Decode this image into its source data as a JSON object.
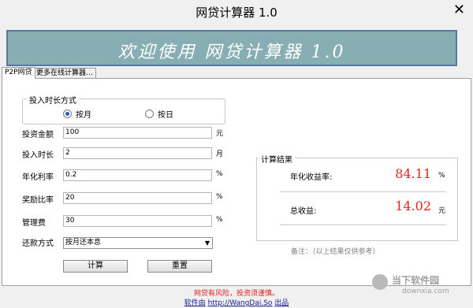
{
  "window": {
    "title": "网贷计算器 1.0",
    "close_glyph": "✕"
  },
  "banner": {
    "text": "欢迎使用  网贷计算器  1.0"
  },
  "tabs": [
    {
      "label": "P2P网贷"
    },
    {
      "label": "更多在线计算器…"
    }
  ],
  "investment_period_mode": {
    "legend": "投入时长方式",
    "options": [
      {
        "label": "按月",
        "checked": true
      },
      {
        "label": "按日",
        "checked": false
      }
    ]
  },
  "fields": {
    "amount": {
      "label": "投资金额",
      "value": "100",
      "unit": "元"
    },
    "duration": {
      "label": "投入时长",
      "value": "2",
      "unit": "月"
    },
    "annual_rate": {
      "label": "年化利率",
      "value": "0.2",
      "unit": "%"
    },
    "reward_rate": {
      "label": "奖励比率",
      "value": "20",
      "unit": "%"
    },
    "management_fee": {
      "label": "管理费",
      "value": "30",
      "unit": "%"
    },
    "repayment": {
      "label": "还款方式",
      "selected": "按月还本息"
    }
  },
  "buttons": {
    "calculate": "计算",
    "reset": "重置"
  },
  "results": {
    "legend": "计算结果",
    "annual_yield": {
      "label": "年化收益率:",
      "value": "84.11",
      "unit": "%"
    },
    "total_income": {
      "label": "总收益:",
      "value": "14.02",
      "unit": "元"
    },
    "note": "备注：（以上结果仅供参考）"
  },
  "footer": {
    "warning": "网贷有风险，投资须谨慎。",
    "credit_prefix": "软件由",
    "credit_link": "http://WangDai.So",
    "credit_suffix": "出品"
  },
  "watermark": {
    "name": "当下软件园",
    "url": "downxia.com"
  },
  "colors": {
    "banner_bg": "#87aeb2",
    "banner_border": "#5778a0",
    "result_value": "#e52020",
    "warning": "#e01c1c"
  }
}
